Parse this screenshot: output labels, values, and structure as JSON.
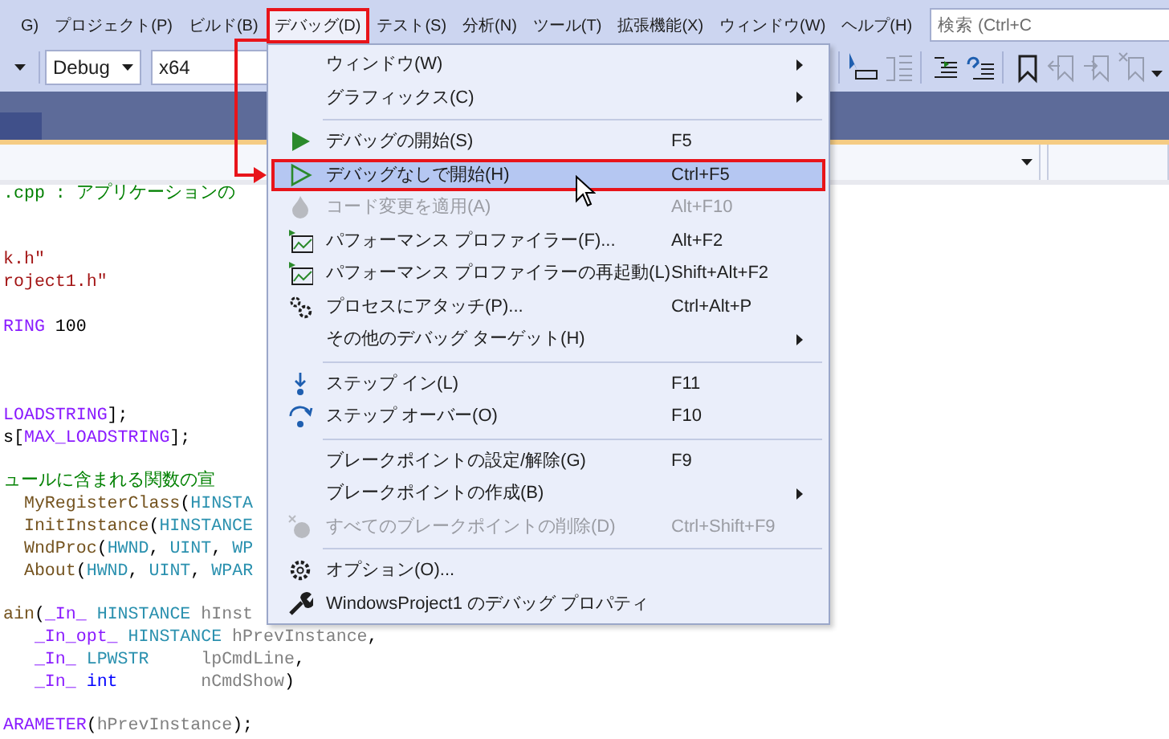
{
  "menu_bar": {
    "items": [
      {
        "label": "G)",
        "selected": false
      },
      {
        "label": "プロジェクト(P)",
        "selected": false
      },
      {
        "label": "ビルド(B)",
        "selected": false
      },
      {
        "label": "デバッグ(D)",
        "selected": true
      },
      {
        "label": "テスト(S)",
        "selected": false
      },
      {
        "label": "分析(N)",
        "selected": false
      },
      {
        "label": "ツール(T)",
        "selected": false
      },
      {
        "label": "拡張機能(X)",
        "selected": false
      },
      {
        "label": "ウィンドウ(W)",
        "selected": false
      },
      {
        "label": "ヘルプ(H)",
        "selected": false
      }
    ],
    "search": {
      "placeholder": "検索 (Ctrl+C"
    }
  },
  "toolbar": {
    "configuration": "Debug",
    "platform": "x64",
    "buttons": [
      {
        "disabled": false
      },
      {
        "disabled": true
      },
      {
        "disabled": false
      },
      {
        "disabled": false
      },
      {
        "disabled": false
      },
      {
        "disabled": true
      },
      {
        "disabled": true
      },
      {
        "disabled": true
      }
    ]
  },
  "editor": {
    "lines": [
      {
        "kind": "code",
        "tokens": [
          {
            "kind": "comment",
            "text": ".cpp : アプリケーションの"
          }
        ]
      },
      {
        "kind": "blank"
      },
      {
        "kind": "blank"
      },
      {
        "kind": "code",
        "tokens": [
          {
            "kind": "string",
            "text": "k.h\""
          }
        ]
      },
      {
        "kind": "code",
        "tokens": [
          {
            "kind": "string",
            "text": "roject1.h\""
          }
        ]
      },
      {
        "kind": "blank"
      },
      {
        "kind": "code",
        "tokens": [
          {
            "kind": "macro",
            "text": "RING"
          },
          {
            "kind": "plain",
            "text": " 100"
          }
        ]
      },
      {
        "kind": "blank"
      },
      {
        "kind": "blank"
      },
      {
        "kind": "blank"
      },
      {
        "kind": "code",
        "tokens": [
          {
            "kind": "macro",
            "text": "LOADSTRING"
          },
          {
            "kind": "plain",
            "text": "];"
          }
        ]
      },
      {
        "kind": "code",
        "tokens": [
          {
            "kind": "plain",
            "text": "s["
          },
          {
            "kind": "macro",
            "text": "MAX_LOADSTRING"
          },
          {
            "kind": "plain",
            "text": "];"
          }
        ]
      },
      {
        "kind": "blank"
      },
      {
        "kind": "code",
        "tokens": [
          {
            "kind": "comment",
            "text": "ュールに含まれる関数の宣"
          }
        ]
      },
      {
        "kind": "code",
        "tokens": [
          {
            "kind": "function",
            "text": "  MyRegisterClass"
          },
          {
            "kind": "plain",
            "text": "("
          },
          {
            "kind": "type",
            "text": "HINSTA"
          }
        ]
      },
      {
        "kind": "code",
        "tokens": [
          {
            "kind": "function",
            "text": "  InitInstance"
          },
          {
            "kind": "plain",
            "text": "("
          },
          {
            "kind": "type",
            "text": "HINSTANCE"
          }
        ]
      },
      {
        "kind": "code",
        "tokens": [
          {
            "kind": "function",
            "text": "  WndProc"
          },
          {
            "kind": "plain",
            "text": "("
          },
          {
            "kind": "type",
            "text": "HWND"
          },
          {
            "kind": "plain",
            "text": ", "
          },
          {
            "kind": "type",
            "text": "UINT"
          },
          {
            "kind": "plain",
            "text": ", "
          },
          {
            "kind": "type",
            "text": "WP"
          }
        ]
      },
      {
        "kind": "code",
        "tokens": [
          {
            "kind": "function",
            "text": "  About"
          },
          {
            "kind": "plain",
            "text": "("
          },
          {
            "kind": "type",
            "text": "HWND"
          },
          {
            "kind": "plain",
            "text": ", "
          },
          {
            "kind": "type",
            "text": "UINT"
          },
          {
            "kind": "plain",
            "text": ", "
          },
          {
            "kind": "type",
            "text": "WPAR"
          }
        ]
      },
      {
        "kind": "blank"
      },
      {
        "kind": "code",
        "tokens": [
          {
            "kind": "function",
            "text": "ain"
          },
          {
            "kind": "plain",
            "text": "("
          },
          {
            "kind": "macro",
            "text": "_In_"
          },
          {
            "kind": "type",
            "text": " HINSTANCE"
          },
          {
            "kind": "param",
            "text": " hInst"
          }
        ]
      },
      {
        "kind": "code",
        "tokens": [
          {
            "kind": "macro",
            "text": "   _In_opt_"
          },
          {
            "kind": "type",
            "text": " HINSTANCE"
          },
          {
            "kind": "param",
            "text": " hPrevInstance"
          },
          {
            "kind": "plain",
            "text": ","
          }
        ]
      },
      {
        "kind": "code",
        "tokens": [
          {
            "kind": "macro",
            "text": "   _In_"
          },
          {
            "kind": "type",
            "text": " LPWSTR"
          },
          {
            "kind": "param",
            "text": "     lpCmdLine"
          },
          {
            "kind": "plain",
            "text": ","
          }
        ]
      },
      {
        "kind": "code",
        "tokens": [
          {
            "kind": "macro",
            "text": "   _In_"
          },
          {
            "kind": "keyword",
            "text": " int"
          },
          {
            "kind": "param",
            "text": "        nCmdShow"
          },
          {
            "kind": "plain",
            "text": ")"
          }
        ]
      },
      {
        "kind": "blank"
      },
      {
        "kind": "code",
        "tokens": [
          {
            "kind": "macro",
            "text": "ARAMETER"
          },
          {
            "kind": "plain",
            "text": "("
          },
          {
            "kind": "param",
            "text": "hPrevInstance"
          },
          {
            "kind": "plain",
            "text": ");"
          }
        ]
      }
    ]
  },
  "debug_menu": {
    "items": [
      {
        "kind": "item",
        "label": "ウィンドウ(W)",
        "submenu": true,
        "disabled": false,
        "selected": false
      },
      {
        "kind": "item",
        "label": "グラフィックス(C)",
        "submenu": true,
        "disabled": false,
        "selected": false
      },
      {
        "kind": "separator"
      },
      {
        "kind": "item",
        "label": "デバッグの開始(S)",
        "shortcut": "F5",
        "submenu": false,
        "disabled": false,
        "selected": false
      },
      {
        "kind": "item",
        "label": "デバッグなしで開始(H)",
        "shortcut": "Ctrl+F5",
        "submenu": false,
        "disabled": false,
        "selected": true
      },
      {
        "kind": "item",
        "label": "コード変更を適用(A)",
        "shortcut": "Alt+F10",
        "submenu": false,
        "disabled": true,
        "selected": false
      },
      {
        "kind": "item",
        "label": "パフォーマンス プロファイラー(F)...",
        "shortcut": "Alt+F2",
        "submenu": false,
        "disabled": false,
        "selected": false
      },
      {
        "kind": "item",
        "label": "パフォーマンス プロファイラーの再起動(L)",
        "shortcut": "Shift+Alt+F2",
        "submenu": false,
        "disabled": false,
        "selected": false
      },
      {
        "kind": "item",
        "label": "プロセスにアタッチ(P)...",
        "shortcut": "Ctrl+Alt+P",
        "submenu": false,
        "disabled": false,
        "selected": false
      },
      {
        "kind": "item",
        "label": "その他のデバッグ ターゲット(H)",
        "submenu": true,
        "disabled": false,
        "selected": false
      },
      {
        "kind": "separator"
      },
      {
        "kind": "item",
        "label": "ステップ イン(L)",
        "shortcut": "F11",
        "submenu": false,
        "disabled": false,
        "selected": false
      },
      {
        "kind": "item",
        "label": "ステップ オーバー(O)",
        "shortcut": "F10",
        "submenu": false,
        "disabled": false,
        "selected": false
      },
      {
        "kind": "separator"
      },
      {
        "kind": "item",
        "label": "ブレークポイントの設定/解除(G)",
        "shortcut": "F9",
        "submenu": false,
        "disabled": false,
        "selected": false
      },
      {
        "kind": "item",
        "label": "ブレークポイントの作成(B)",
        "submenu": true,
        "disabled": false,
        "selected": false
      },
      {
        "kind": "item",
        "label": "すべてのブレークポイントの削除(D)",
        "shortcut": "Ctrl+Shift+F9",
        "submenu": false,
        "disabled": true,
        "selected": false
      },
      {
        "kind": "separator"
      },
      {
        "kind": "item",
        "label": "オプション(O)...",
        "submenu": false,
        "disabled": false,
        "selected": false
      },
      {
        "kind": "item",
        "label": "WindowsProject1 のデバッグ プロパティ",
        "submenu": false,
        "disabled": false,
        "selected": false
      }
    ]
  }
}
